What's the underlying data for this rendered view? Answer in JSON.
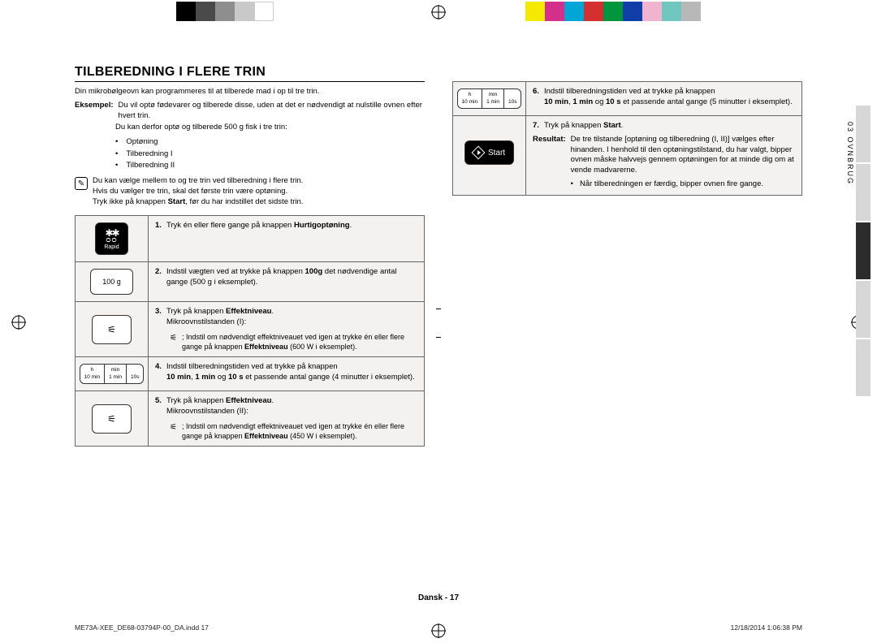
{
  "heading": "TILBEREDNING I FLERE TRIN",
  "intro": "Din mikrobølgeovn kan programmeres til at tilberede mad i op til tre trin.",
  "example_label": "Eksempel:",
  "example_body1": "Du vil optø fødevarer og tilberede disse, uden at det er nødvendigt at nulstille ovnen efter hvert trin.",
  "example_body2": "Du kan derfor optø og tilberede 500 g fisk i tre trin:",
  "bullets": [
    "Optøning",
    "Tilberedning I",
    "Tilberedning II"
  ],
  "note_icon": "✎",
  "note1": "Du kan vælge mellem to og tre trin ved tilberedning i flere trin.",
  "note2": "Hvis du vælger tre trin, skal det første trin være optøning.",
  "note3_a": "Tryk ikke på knappen ",
  "note3_b": "Start",
  "note3_c": ", før du har indstillet det sidste trin.",
  "step1_num": "1.",
  "step1_a": "Tryk én eller flere gange på knappen ",
  "step1_b": "Hurtigoptøning",
  "step1_c": ".",
  "step2_num": "2.",
  "step2_a": "Indstil vægten ved at trykke på knappen ",
  "step2_b": "100g",
  "step2_c": " det nødvendige antal gange (500 g i eksemplet).",
  "step3_num": "3.",
  "step3_a": "Tryk på knappen ",
  "step3_b": "Effektniveau",
  "step3_c": ".",
  "step3_sub": "Mikroovnstilstanden (I):",
  "step3_note": "; Indstil om nødvendigt effektniveauet ved igen at trykke én eller flere gange på knappen ",
  "step3_note_b": "Effektniveau",
  "step3_note_c": " (600 W i eksemplet).",
  "step4_num": "4.",
  "step4_a": "Indstil tilberedningstiden ved at trykke på knappen",
  "step4_b": "10 min",
  "step4_c": ", ",
  "step4_d": "1 min",
  "step4_e": " og ",
  "step4_f": "10 s",
  "step4_g": " et passende antal gange (4 minutter i eksemplet).",
  "step5_num": "5.",
  "step5_a": "Tryk på knappen ",
  "step5_b": "Effektniveau",
  "step5_c": ".",
  "step5_sub": "Mikroovnstilstanden (II):",
  "step5_note": "; Indstil om nødvendigt effektniveauet ved igen at trykke én eller flere gange på knappen ",
  "step5_note_b": "Effektniveau",
  "step5_note_c": " (450 W i eksemplet).",
  "step6_num": "6.",
  "step6_a": "Indstil tilberedningstiden ved at trykke på knappen",
  "step6_b": "10 min",
  "step6_c": ", ",
  "step6_d": "1 min",
  "step6_e": " og ",
  "step6_f": "10 s",
  "step6_g": " et passende antal gange (5 minutter i eksemplet).",
  "step7_num": "7.",
  "step7_a": "Tryk på knappen ",
  "step7_b": "Start",
  "step7_c": ".",
  "result_label": "Resultat:",
  "result_body": "De tre tilstande [optøning og tilberedning (I, II)] vælges efter hinanden. I henhold til den optøningstilstand, du har valgt, bipper ovnen måske halvvejs gennem optøningen for at minde dig om at vende madvarerne.",
  "result_bullet": "Når tilberedningen er færdig, bipper ovnen fire gange.",
  "btn_rapid_label": "Rapid",
  "btn_100g": "100 g",
  "btn_start_label": "Start",
  "timer": {
    "h": "h",
    "h2": "10 min",
    "m": "min",
    "m2": "1 min",
    "s": "10s"
  },
  "tab_label": "03  OVNBRUG",
  "footer_center": "Dansk - 17",
  "footer_left": "ME73A-XEE_DE68-03794P-00_DA.indd   17",
  "footer_right": "12/18/2014   1:06:38 PM",
  "colorbar": [
    "#000000",
    "#4a4a4a",
    "#8e8e8e",
    "#c9c9c9",
    "#ffffff",
    "#f3ea00",
    "#d42f8a",
    "#00a6d6",
    "#d62f2f",
    "#009640",
    "#0f3ea8",
    "#f2b3cf",
    "#6fc7c0",
    "#b8b8b8"
  ]
}
